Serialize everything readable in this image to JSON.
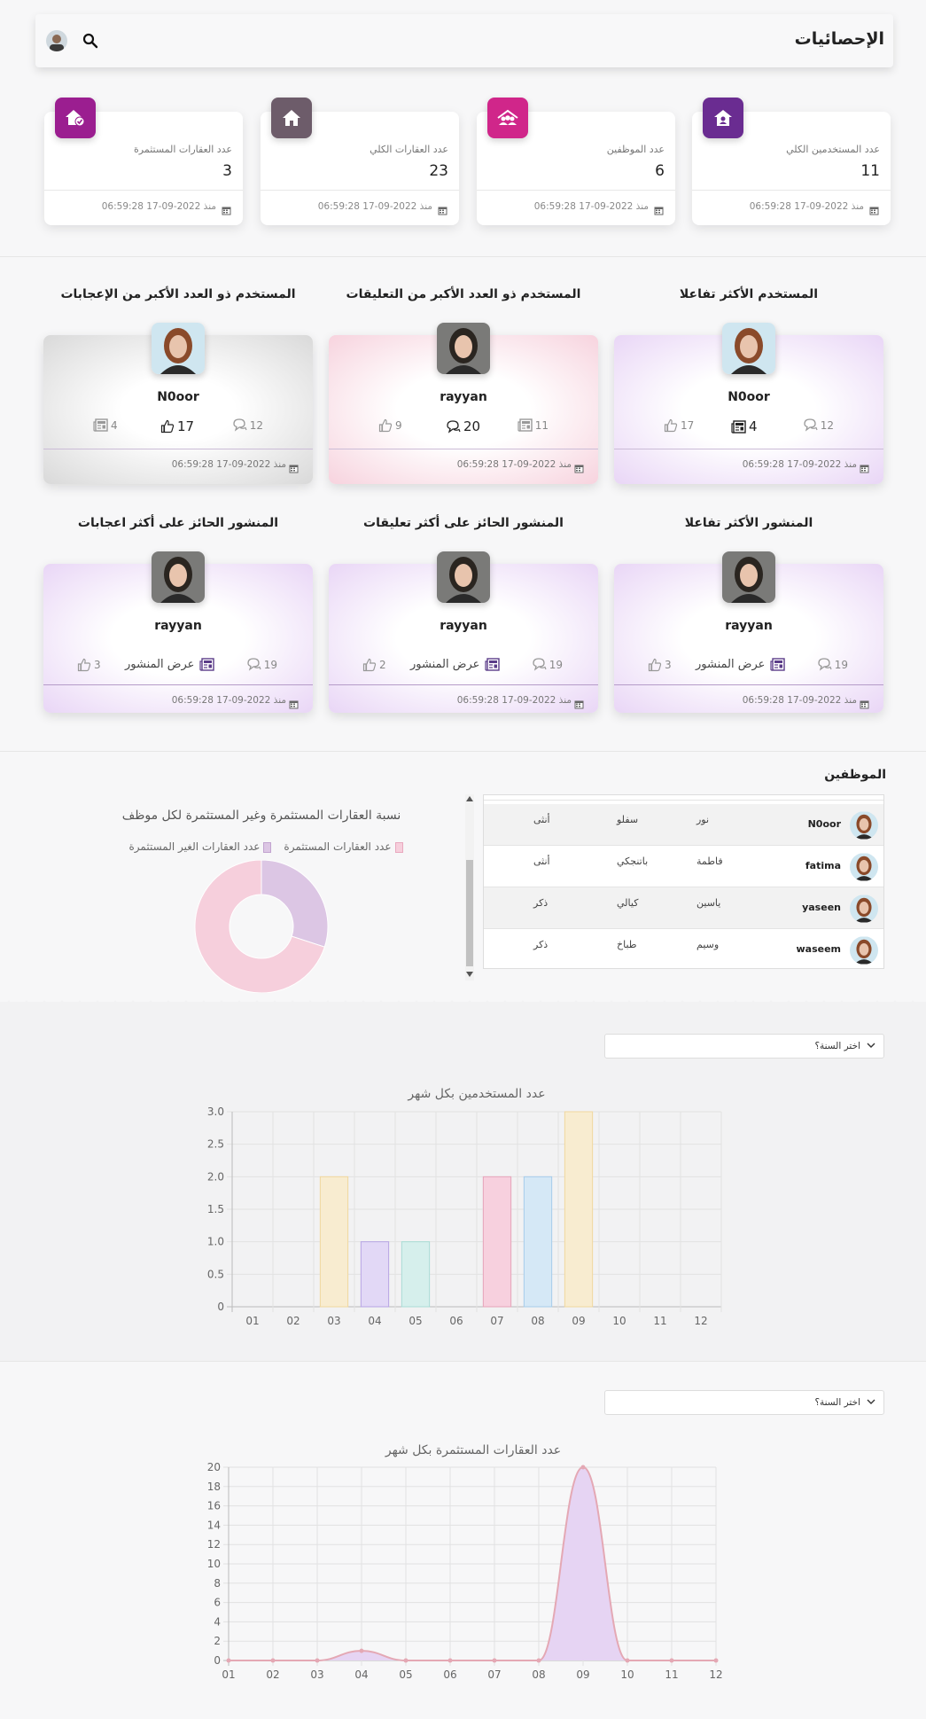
{
  "header": {
    "title": "الإحصائيات"
  },
  "stats": [
    {
      "label": "عدد المستخدمين الكلي",
      "value": "11",
      "date": "منذ 2022-09-17 06:59:28",
      "icon": "home-user-icon",
      "color": "#6a2c91"
    },
    {
      "label": "عدد الموظفين",
      "value": "6",
      "date": "منذ 2022-09-17 06:59:28",
      "icon": "people-icon",
      "color": "#d0268a"
    },
    {
      "label": "عدد العقارات الكلي",
      "value": "23",
      "date": "منذ 2022-09-17 06:59:28",
      "icon": "house-icon",
      "color": "#6d5c6a"
    },
    {
      "label": "عدد العقارات المستثمرة",
      "value": "3",
      "date": "منذ 2022-09-17 06:59:28",
      "icon": "house-check-icon",
      "color": "#9b1e90"
    }
  ],
  "users": [
    {
      "title": "المستخدم الأكثر تفاعلا",
      "name": "N0oor",
      "comments": "12",
      "mid": "4",
      "side": "17",
      "date": "منذ 2022-09-17 06:59:28"
    },
    {
      "title": "المستخدم ذو العدد الأكبر من التعليقات",
      "name": "rayyan",
      "comments": "11",
      "mid": "20",
      "side": "9",
      "date": "منذ 2022-09-17 06:59:28"
    },
    {
      "title": "المستخدم ذو العدد الأكبر من الإعجابات",
      "name": "N0oor",
      "comments": "12",
      "mid": "17",
      "side": "4",
      "date": "منذ 2022-09-17 06:59:28"
    }
  ],
  "posts": [
    {
      "title": "المنشور الأكثر تفاعلا",
      "name": "rayyan",
      "comments": "19",
      "view": "عرض المنشور",
      "likes": "3",
      "date": "منذ 2022-09-17 06:59:28"
    },
    {
      "title": "المنشور الحائز على أكثر تعليقات",
      "name": "rayyan",
      "comments": "19",
      "view": "عرض المنشور",
      "likes": "2",
      "date": "منذ 2022-09-17 06:59:28"
    },
    {
      "title": "المنشور الحائز على أكثر اعجابات",
      "name": "rayyan",
      "comments": "19",
      "view": "عرض المنشور",
      "likes": "3",
      "date": "منذ 2022-09-17 06:59:28"
    }
  ],
  "employees": {
    "title": "الموظفين",
    "rows": [
      {
        "username": "N0oor",
        "first": "نور",
        "last": "سفلو",
        "gender": "أنثى"
      },
      {
        "username": "fatima",
        "first": "فاطمة",
        "last": "باتنجكي",
        "gender": "أنثى"
      },
      {
        "username": "yaseen",
        "first": "ياسين",
        "last": "كيالي",
        "gender": "ذكر"
      },
      {
        "username": "waseem",
        "first": "وسيم",
        "last": "طباخ",
        "gender": "ذكر"
      }
    ]
  },
  "pie": {
    "chart_data": {
      "type": "pie",
      "title": "نسبة العقارات المستثمرة وغير المستثمرة لكل موظف",
      "series": [
        {
          "name": "عدد العقارات المستثمرة",
          "value": 3,
          "color": "#dcc6e4"
        },
        {
          "name": "عدد العقارات الغير المستثمرة",
          "value": 7,
          "color": "#f6cfdc"
        }
      ]
    }
  },
  "users_chart": {
    "select_label": "اختر السنة؟",
    "chart_data": {
      "type": "bar",
      "title": "عدد المستخدمين بكل شهر",
      "categories": [
        "01",
        "02",
        "03",
        "04",
        "05",
        "06",
        "07",
        "08",
        "09",
        "10",
        "11",
        "12"
      ],
      "values": [
        0,
        0,
        2,
        1,
        1,
        0,
        2,
        2,
        3,
        0,
        0,
        0
      ],
      "colors": [
        "#f6d8da",
        "#f6d8da",
        "#f8ecd0",
        "#e2d8f6",
        "#d6efec",
        "#f6d8da",
        "#f7d0de",
        "#d5e8f6",
        "#f8ecd0",
        "#f6d8da",
        "#f6d8da",
        "#f6d8da"
      ],
      "borders": [
        "#e8a0a8",
        "#e8a0a8",
        "#f0d79e",
        "#b7a4e4",
        "#a9dcd6",
        "#e8a0a8",
        "#e6a4ba",
        "#a7ccea",
        "#f0d79e",
        "#e8a0a8",
        "#e8a0a8",
        "#e8a0a8"
      ],
      "yticks": [
        "0",
        "0.5",
        "1.0",
        "1.5",
        "2.0",
        "2.5",
        "3.0"
      ],
      "ylim": [
        0,
        3
      ]
    }
  },
  "invested_chart": {
    "select_label": "اختر السنة؟",
    "chart_data": {
      "type": "area",
      "title": "عدد العقارات المستثمرة بكل شهر",
      "categories": [
        "01",
        "02",
        "03",
        "04",
        "05",
        "06",
        "07",
        "08",
        "09",
        "10",
        "11",
        "12"
      ],
      "values": [
        0,
        0,
        0,
        1,
        0,
        0,
        0,
        0,
        20,
        0,
        0,
        0
      ],
      "yticks": [
        "0",
        "2",
        "4",
        "6",
        "8",
        "10",
        "12",
        "14",
        "16",
        "18",
        "20"
      ],
      "ylim": [
        0,
        20
      ],
      "fill": "#e6d4f3",
      "line": "#e4a8b4"
    }
  }
}
